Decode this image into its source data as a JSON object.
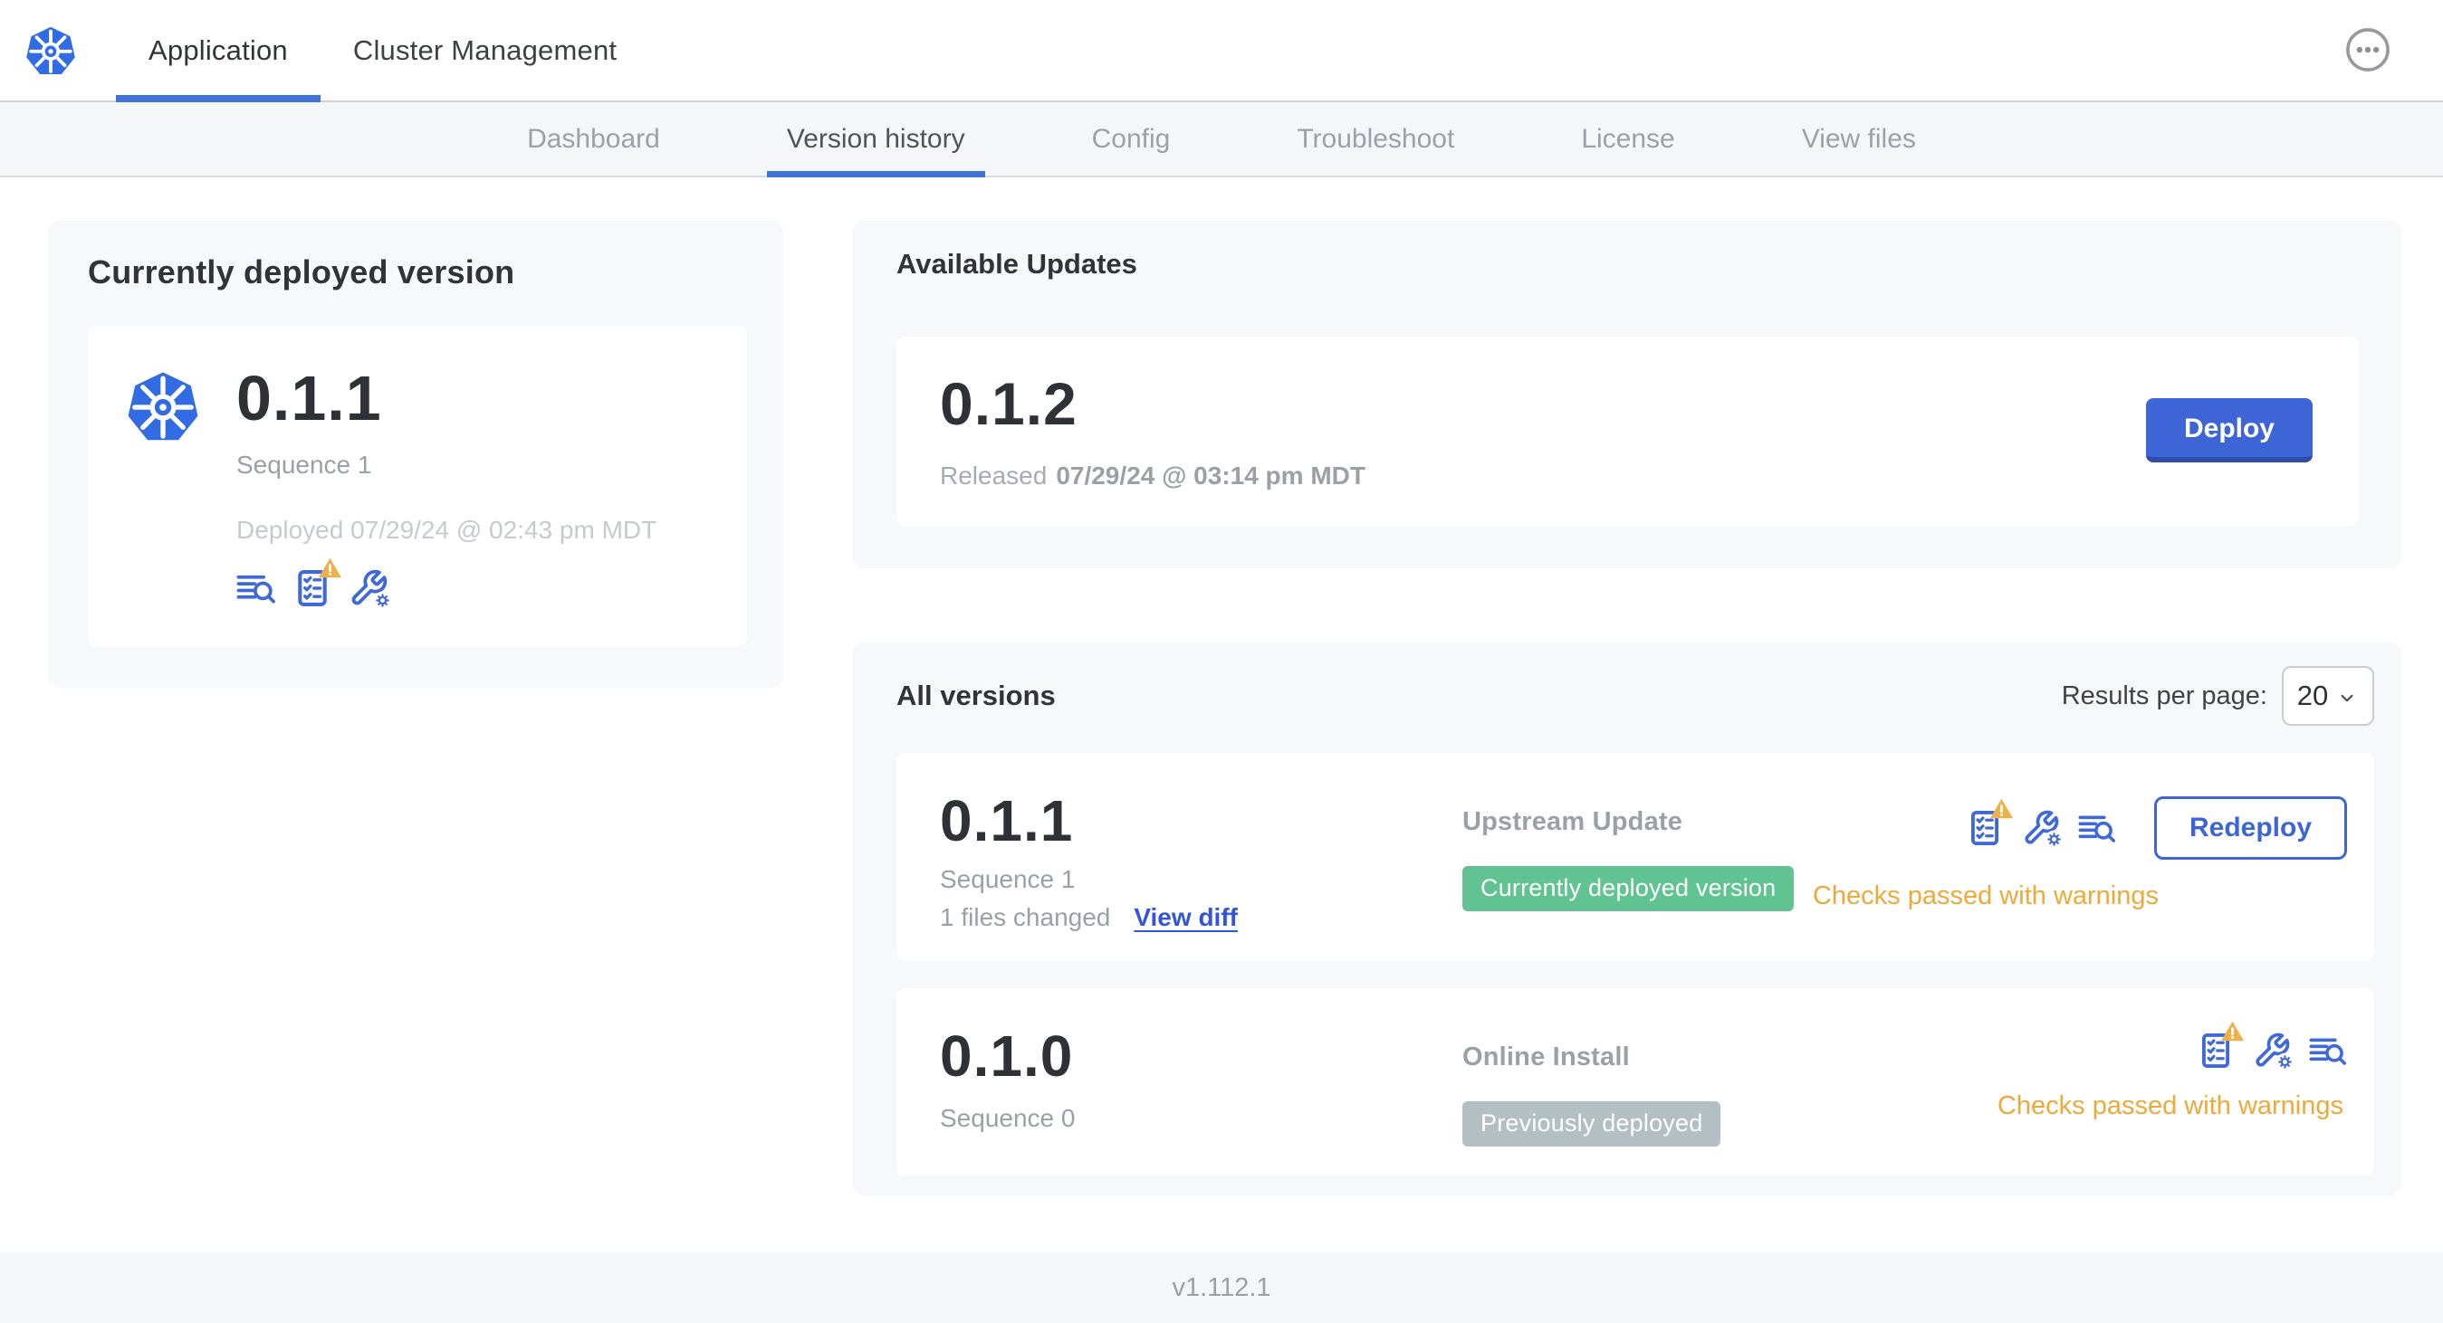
{
  "nav": {
    "tabs": [
      {
        "label": "Application",
        "active": true
      },
      {
        "label": "Cluster Management",
        "active": false
      }
    ],
    "menu_icon": "ellipsis-icon"
  },
  "subnav": {
    "tabs": [
      {
        "label": "Dashboard",
        "active": false
      },
      {
        "label": "Version history",
        "active": true
      },
      {
        "label": "Config",
        "active": false
      },
      {
        "label": "Troubleshoot",
        "active": false
      },
      {
        "label": "License",
        "active": false
      },
      {
        "label": "View files",
        "active": false
      }
    ]
  },
  "current": {
    "title": "Currently deployed version",
    "version": "0.1.1",
    "sequence": "Sequence 1",
    "deployed": "Deployed 07/29/24 @ 02:43 pm MDT",
    "icons": [
      "logs-icon",
      "preflight-checks-warning-icon",
      "config-wrench-icon"
    ]
  },
  "updates": {
    "title": "Available Updates",
    "version": "0.1.2",
    "released_prefix": "Released",
    "released_date": "07/29/24 @ 03:14 pm MDT",
    "deploy_label": "Deploy"
  },
  "versions": {
    "title": "All versions",
    "results_per_page_label": "Results per page:",
    "results_per_page_value": "20",
    "rows": [
      {
        "version": "0.1.1",
        "sequence": "Sequence 1",
        "files_changed": "1 files changed",
        "view_diff_label": "View diff",
        "source": "Upstream Update",
        "badge": "Currently deployed version",
        "badge_color": "#61c392",
        "status": "Checks passed with warnings",
        "action_label": "Redeploy",
        "icons": [
          "preflight-checks-warning-icon",
          "config-wrench-icon",
          "logs-icon"
        ]
      },
      {
        "version": "0.1.0",
        "sequence": "Sequence 0",
        "source": "Online Install",
        "badge": "Previously deployed",
        "badge_color": "#b4bfc3",
        "status": "Checks passed with warnings",
        "icons": [
          "preflight-checks-warning-icon",
          "config-wrench-icon",
          "logs-icon"
        ]
      }
    ]
  },
  "footer": {
    "app_version": "v1.112.1"
  },
  "colors": {
    "accent_blue": "#3e65d6",
    "kubernetes_blue": "#326ce5",
    "warning_orange": "#eda93a",
    "badge_green": "#61c392",
    "badge_gray": "#b4bfc3",
    "subnav_bg": "#f5f6f8",
    "panel_bg": "#f7f8fa"
  }
}
